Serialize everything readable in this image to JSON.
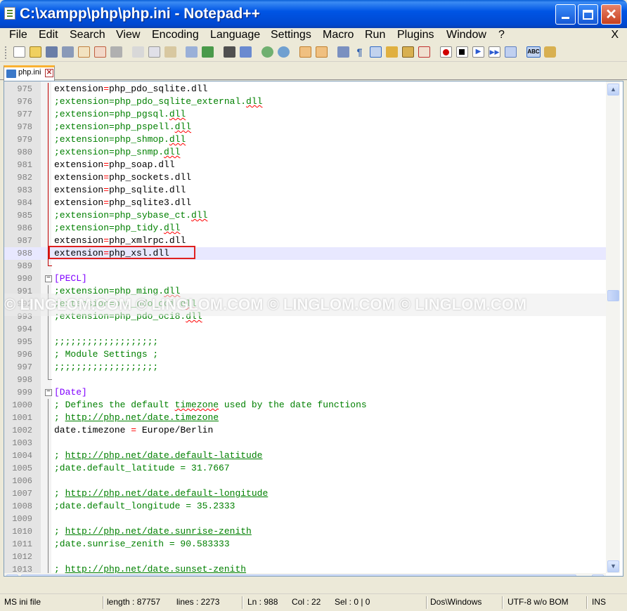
{
  "window": {
    "title": "C:\\xampp\\php\\php.ini - Notepad++",
    "controls": [
      "minimize",
      "maximize",
      "close"
    ]
  },
  "menu": {
    "items": [
      "File",
      "Edit",
      "Search",
      "View",
      "Encoding",
      "Language",
      "Settings",
      "Macro",
      "Run",
      "Plugins",
      "Window",
      "?"
    ],
    "close_label": "X"
  },
  "toolbar": {
    "icons": [
      "new-file-icon",
      "open-file-icon",
      "save-icon",
      "save-all-icon",
      "close-icon",
      "close-all-icon",
      "print-icon",
      "cut-icon",
      "copy-icon",
      "paste-icon",
      "undo-icon",
      "redo-icon",
      "find-icon",
      "replace-icon",
      "zoom-in-icon",
      "zoom-out-icon",
      "sync-vertical-icon",
      "sync-horizontal-icon",
      "word-wrap-icon",
      "show-all-chars-icon",
      "indent-guide-icon",
      "user-language-icon",
      "function-list-icon",
      "doc-map-icon",
      "record-macro-icon",
      "stop-macro-icon",
      "play-macro-icon",
      "run-macro-multiple-icon",
      "save-macro-icon",
      "spell-check-icon",
      "misc-icon"
    ],
    "colors": {
      "record": "#d00000",
      "stop": "#000000",
      "play": "#2a5ad0"
    }
  },
  "tab": {
    "label": "php.ini",
    "close": "✕"
  },
  "editor": {
    "lines": [
      {
        "n": "975",
        "key": "extension",
        "eq": "=",
        "val": "php_pdo_sqlite.dll",
        "kind": "kv",
        "fold": "line"
      },
      {
        "n": "976",
        "text": ";extension=php_pdo_sqlite_external.",
        "squig": "dll",
        "kind": "comment",
        "fold": "line"
      },
      {
        "n": "977",
        "text": ";extension=php_pgsql.",
        "squig": "dll",
        "kind": "comment",
        "fold": "line"
      },
      {
        "n": "978",
        "text": ";extension=php_pspell.",
        "squig": "dll",
        "kind": "comment",
        "fold": "line"
      },
      {
        "n": "979",
        "text": ";extension=php_shmop.",
        "squig": "dll",
        "kind": "comment",
        "fold": "line"
      },
      {
        "n": "980",
        "text": ";extension=php_snmp.",
        "squig": "dll",
        "kind": "comment",
        "fold": "line"
      },
      {
        "n": "981",
        "key": "extension",
        "eq": "=",
        "val": "php_soap.dll",
        "kind": "kv",
        "fold": "line"
      },
      {
        "n": "982",
        "key": "extension",
        "eq": "=",
        "val": "php_sockets.dll",
        "kind": "kv",
        "fold": "line"
      },
      {
        "n": "983",
        "key": "extension",
        "eq": "=",
        "val": "php_sqlite.dll",
        "kind": "kv",
        "fold": "line"
      },
      {
        "n": "984",
        "key": "extension",
        "eq": "=",
        "val": "php_sqlite3.dll",
        "kind": "kv",
        "fold": "line"
      },
      {
        "n": "985",
        "text": ";extension=php_sybase_ct.",
        "squig": "dll",
        "kind": "comment",
        "fold": "line"
      },
      {
        "n": "986",
        "text": ";extension=php_tidy.",
        "squig": "dll",
        "kind": "comment",
        "fold": "line"
      },
      {
        "n": "987",
        "key": "extension",
        "eq": "=",
        "val": "php_xmlrpc.dll",
        "kind": "kv",
        "fold": "line"
      },
      {
        "n": "988",
        "key": "extension",
        "eq": "=",
        "val": "php_xsl.dll",
        "kind": "kv",
        "fold": "line",
        "current": true
      },
      {
        "n": "989",
        "text": "",
        "kind": "blank",
        "fold": "end"
      },
      {
        "n": "990",
        "text": "[PECL]",
        "kind": "section",
        "fold": "box"
      },
      {
        "n": "991",
        "text": ";extension=php_ming.",
        "squig": "dll",
        "kind": "comment",
        "fold": "gline"
      },
      {
        "n": "992",
        "text": ";extension=php_pdo_oci.",
        "squig": "dll",
        "kind": "comment",
        "fold": "gline"
      },
      {
        "n": "993",
        "text": ";extension=php_pdo_oci8.",
        "squig": "dll",
        "kind": "comment",
        "fold": "gline"
      },
      {
        "n": "994",
        "text": "",
        "kind": "blank",
        "fold": "gline"
      },
      {
        "n": "995",
        "text": ";;;;;;;;;;;;;;;;;;;",
        "kind": "comment",
        "fold": "gline"
      },
      {
        "n": "996",
        "text": "; Module Settings ;",
        "kind": "comment",
        "fold": "gline"
      },
      {
        "n": "997",
        "text": ";;;;;;;;;;;;;;;;;;;",
        "kind": "comment",
        "fold": "gline"
      },
      {
        "n": "998",
        "text": "",
        "kind": "blank",
        "fold": "gend"
      },
      {
        "n": "999",
        "text": "[Date]",
        "kind": "section",
        "fold": "box"
      },
      {
        "n": "1000",
        "pre": "; Defines the default ",
        "squig": "timezone",
        "post": " used by the date functions",
        "kind": "comment-mixed",
        "fold": "gline"
      },
      {
        "n": "1001",
        "pre": "; ",
        "url": "http://php.net/date.timezone",
        "kind": "comment-url",
        "fold": "gline"
      },
      {
        "n": "1002",
        "key": "date.timezone ",
        "eq": "=",
        "val": " Europe/Berlin",
        "kind": "kv",
        "fold": "gline"
      },
      {
        "n": "1003",
        "text": "",
        "kind": "blank",
        "fold": "gline"
      },
      {
        "n": "1004",
        "pre": "; ",
        "url": "http://php.net/date.default-latitude",
        "kind": "comment-url",
        "fold": "gline"
      },
      {
        "n": "1005",
        "text": ";date.default_latitude = 31.7667",
        "kind": "comment",
        "fold": "gline"
      },
      {
        "n": "1006",
        "text": "",
        "kind": "blank",
        "fold": "gline"
      },
      {
        "n": "1007",
        "pre": "; ",
        "url": "http://php.net/date.default-longitude",
        "kind": "comment-url",
        "fold": "gline"
      },
      {
        "n": "1008",
        "text": ";date.default_longitude = 35.2333",
        "kind": "comment",
        "fold": "gline"
      },
      {
        "n": "1009",
        "text": "",
        "kind": "blank",
        "fold": "gline"
      },
      {
        "n": "1010",
        "pre": "; ",
        "url": "http://php.net/date.sunrise-zenith",
        "kind": "comment-url",
        "fold": "gline"
      },
      {
        "n": "1011",
        "text": ";date.sunrise_zenith = 90.583333",
        "kind": "comment",
        "fold": "gline"
      },
      {
        "n": "1012",
        "text": "",
        "kind": "blank",
        "fold": "gline"
      },
      {
        "n": "1013",
        "pre": "; ",
        "url": "http://php.net/date.sunset-zenith",
        "kind": "comment-url",
        "fold": "gline"
      }
    ],
    "watermark": "© LINGLOM.COM    © LINGLOM.COM    © LINGLOM.COM    © LINGLOM.COM"
  },
  "status": {
    "file_type": "MS ini file",
    "length": "length : 87757",
    "lines": "lines : 2273",
    "ln": "Ln : 988",
    "col": "Col : 22",
    "sel": "Sel : 0 | 0",
    "eol": "Dos\\Windows",
    "encoding": "UTF-8 w/o BOM",
    "mode": "INS"
  }
}
